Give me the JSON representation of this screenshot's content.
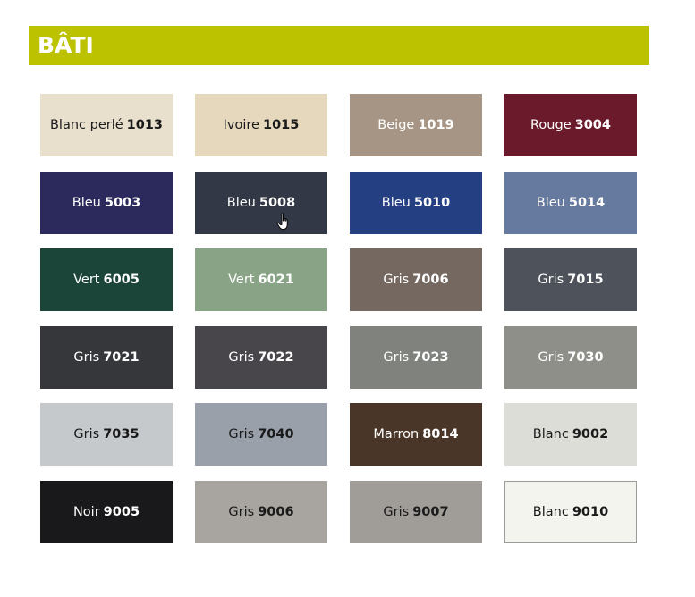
{
  "header": {
    "title": "BÂTI",
    "bar_color": "#bcc100"
  },
  "swatches": [
    {
      "name": "Blanc perlé",
      "code": "1013",
      "color": "#e8dfcd",
      "text_color": "#1a1a1a"
    },
    {
      "name": "Ivoire",
      "code": "1015",
      "color": "#e6d8bd",
      "text_color": "#1a1a1a"
    },
    {
      "name": "Beige",
      "code": "1019",
      "color": "#a69584",
      "text_color": "#ffffff"
    },
    {
      "name": "Rouge",
      "code": "3004",
      "color": "#6b1a2b",
      "text_color": "#ffffff"
    },
    {
      "name": "Bleu",
      "code": "5003",
      "color": "#2c2a5d",
      "text_color": "#ffffff"
    },
    {
      "name": "Bleu",
      "code": "5008",
      "color": "#323845",
      "text_color": "#ffffff"
    },
    {
      "name": "Bleu",
      "code": "5010",
      "color": "#243f82",
      "text_color": "#ffffff"
    },
    {
      "name": "Bleu",
      "code": "5014",
      "color": "#657a9e",
      "text_color": "#ffffff"
    },
    {
      "name": "Vert",
      "code": "6005",
      "color": "#1c4539",
      "text_color": "#ffffff"
    },
    {
      "name": "Vert",
      "code": "6021",
      "color": "#89a386",
      "text_color": "#ffffff"
    },
    {
      "name": "Gris",
      "code": "7006",
      "color": "#756860",
      "text_color": "#ffffff"
    },
    {
      "name": "Gris",
      "code": "7015",
      "color": "#4e525a",
      "text_color": "#ffffff"
    },
    {
      "name": "Gris",
      "code": "7021",
      "color": "#35373a",
      "text_color": "#ffffff"
    },
    {
      "name": "Gris",
      "code": "7022",
      "color": "#48464a",
      "text_color": "#ffffff"
    },
    {
      "name": "Gris",
      "code": "7023",
      "color": "#7f827d",
      "text_color": "#ffffff"
    },
    {
      "name": "Gris",
      "code": "7030",
      "color": "#8f8f8a",
      "text_color": "#ffffff"
    },
    {
      "name": "Gris",
      "code": "7035",
      "color": "#c5c9cc",
      "text_color": "#1a1a1a"
    },
    {
      "name": "Gris",
      "code": "7040",
      "color": "#9aa0aa",
      "text_color": "#1a1a1a"
    },
    {
      "name": "Marron",
      "code": "8014",
      "color": "#4a3629",
      "text_color": "#ffffff"
    },
    {
      "name": "Blanc",
      "code": "9002",
      "color": "#dcddd7",
      "text_color": "#1a1a1a"
    },
    {
      "name": "Noir",
      "code": "9005",
      "color": "#19191b",
      "text_color": "#ffffff"
    },
    {
      "name": "Gris",
      "code": "9006",
      "color": "#a8a49f",
      "text_color": "#1a1a1a"
    },
    {
      "name": "Gris",
      "code": "9007",
      "color": "#a09c98",
      "text_color": "#1a1a1a"
    },
    {
      "name": "Blanc",
      "code": "9010",
      "color": "#f3f4ee",
      "text_color": "#1a1a1a",
      "bordered": true
    }
  ]
}
